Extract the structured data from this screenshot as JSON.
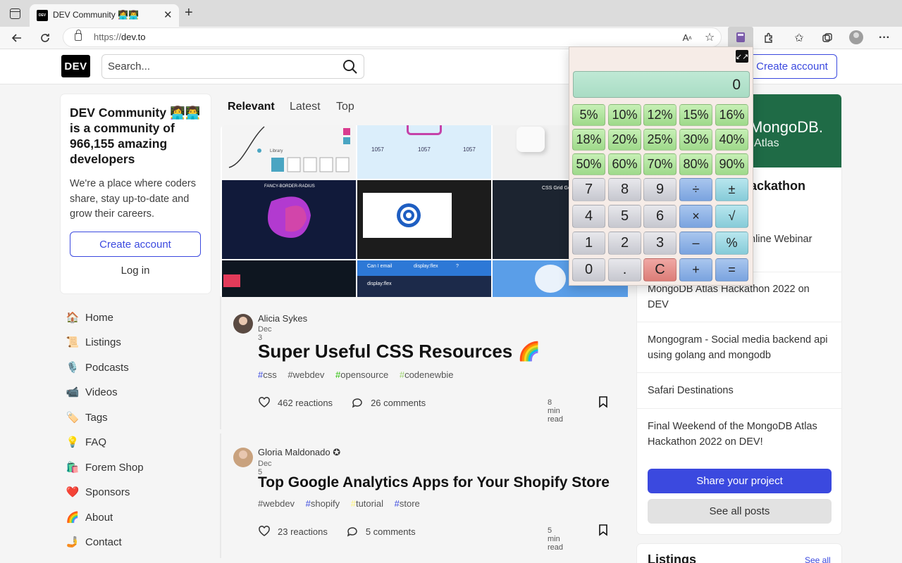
{
  "browser": {
    "tab_title": "DEV Community 👩‍💻👨‍💻",
    "tab_favicon": "DEV",
    "url_scheme": "https://",
    "url_host": "dev.to"
  },
  "header": {
    "logo": "DEV",
    "search_placeholder": "Search...",
    "create_account": "Create account"
  },
  "intro": {
    "title": "DEV Community 👩‍💻👨‍💻 is a community of 966,155 amazing developers",
    "text": "We're a place where coders share, stay up-to-date and grow their careers.",
    "create_account": "Create account",
    "login": "Log in"
  },
  "nav": [
    {
      "emoji": "🏠",
      "label": "Home"
    },
    {
      "emoji": "📜",
      "label": "Listings"
    },
    {
      "emoji": "🎙️",
      "label": "Podcasts"
    },
    {
      "emoji": "📹",
      "label": "Videos"
    },
    {
      "emoji": "🏷️",
      "label": "Tags"
    },
    {
      "emoji": "💡",
      "label": "FAQ"
    },
    {
      "emoji": "🛍️",
      "label": "Forem Shop"
    },
    {
      "emoji": "❤️",
      "label": "Sponsors"
    },
    {
      "emoji": "🌈",
      "label": "About"
    },
    {
      "emoji": "🤳",
      "label": "Contact"
    }
  ],
  "feed_tabs": [
    "Relevant",
    "Latest",
    "Top"
  ],
  "posts": [
    {
      "author": "Alicia Sykes",
      "date": "Dec 3",
      "title": "Super Useful CSS Resources 🌈",
      "tags": [
        {
          "hash": "#",
          "name": "css",
          "color": "#3b49df"
        },
        {
          "hash": "#",
          "name": "webdev",
          "color": "#555555"
        },
        {
          "hash": "#",
          "name": "opensource",
          "color": "#26be00"
        },
        {
          "hash": "#",
          "name": "codenewbie",
          "color": "#9bd36e"
        }
      ],
      "reactions": "462 reactions",
      "comments": "26 comments",
      "read_time": "8 min read"
    },
    {
      "author": "Gloria Maldonado ✪",
      "date": "Dec 5",
      "title": "Top Google Analytics Apps for Your Shopify Store",
      "tags": [
        {
          "hash": "#",
          "name": "webdev",
          "color": "#555555"
        },
        {
          "hash": "#",
          "name": "shopify",
          "color": "#3b49df"
        },
        {
          "hash": "#",
          "name": "tutorial",
          "color": "#fef37b"
        },
        {
          "hash": "#",
          "name": "store",
          "color": "#3b49df"
        }
      ],
      "reactions": "23 reactions",
      "comments": "5 comments",
      "read_time": "5 min read"
    }
  ],
  "cover_texts": {
    "library": "Library",
    "fancy": "FANCY-BORDER-RADIUS",
    "grid_gen": "CSS Grid Ge",
    "num": "1057",
    "can_email": "Can I email",
    "display_flex": "display:flex",
    "q": "?"
  },
  "sidebar": {
    "brand": "MongoDB.",
    "brand_sub": "Atlas",
    "hackathon": "ackathon",
    "links": [
      "nline Webinar",
      "MongoDB Atlas Hackathon 2022 on DEV",
      "Mongogram - Social media backend api using golang and mongodb",
      "Safari Destinations",
      "Final Weekend of the MongoDB Atlas Hackathon 2022 on DEV!"
    ],
    "share": "Share your project",
    "see_all": "See all posts",
    "listings": "Listings",
    "listings_see_all": "See all"
  },
  "calculator": {
    "display": "0",
    "expand_icon": "↙↗",
    "percent_keys": [
      "5%",
      "10%",
      "12%",
      "15%",
      "16%",
      "18%",
      "20%",
      "25%",
      "30%",
      "40%",
      "50%",
      "60%",
      "70%",
      "80%",
      "90%"
    ],
    "keys": [
      [
        "7",
        "8",
        "9",
        "÷",
        "±"
      ],
      [
        "4",
        "5",
        "6",
        "×",
        "√"
      ],
      [
        "1",
        "2",
        "3",
        "–",
        "%"
      ],
      [
        "0",
        ".",
        "C",
        "+",
        "="
      ]
    ]
  },
  "colors": {
    "accent": "#3b49df",
    "mongo_green": "#1f6b46"
  }
}
